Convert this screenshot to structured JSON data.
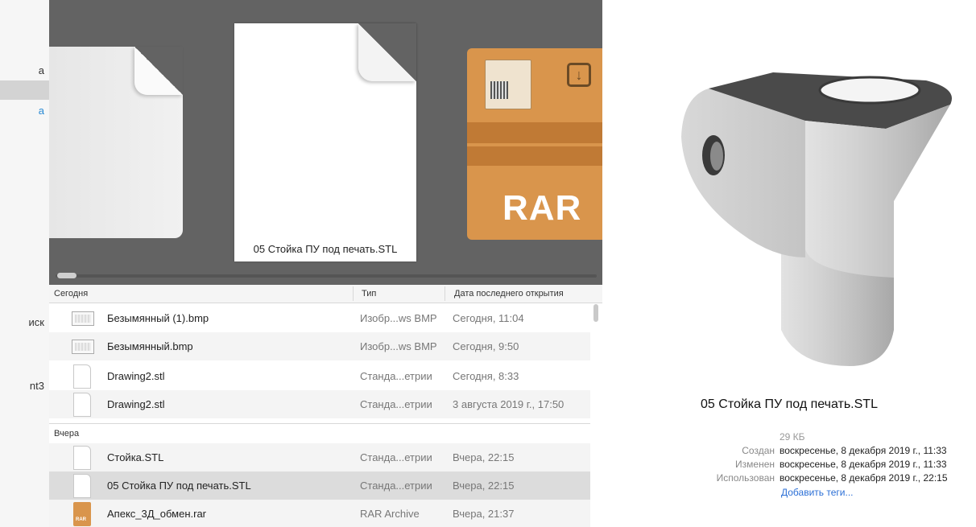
{
  "sidebar": {
    "items": [
      {
        "label": "a",
        "selected": false
      },
      {
        "label": "",
        "selected": true
      },
      {
        "label": "a",
        "selected": false
      },
      {
        "label": "иск",
        "selected": false
      },
      {
        "label": "nt3",
        "selected": false
      }
    ]
  },
  "coverflow": {
    "current_caption": "05 Стойка ПУ под печать.STL",
    "rar_label": "RAR"
  },
  "list": {
    "columns": {
      "name": "Сегодня",
      "type": "Тип",
      "date": "Дата последнего открытия"
    },
    "today_rows": [
      {
        "name": "Безымянный (1).bmp",
        "type": "Изобр...ws BMP",
        "date": "Сегодня, 11:04",
        "icon": "bmp-file-icon"
      },
      {
        "name": "Безымянный.bmp",
        "type": "Изобр...ws BMP",
        "date": "Сегодня, 9:50",
        "icon": "bmp-file-icon"
      },
      {
        "name": "Drawing2.stl",
        "type": "Станда...етрии",
        "date": "Сегодня, 8:33",
        "icon": "stl-file-icon"
      },
      {
        "name": "Drawing2.stl",
        "type": "Станда...етрии",
        "date": "3 августа 2019 г., 17:50",
        "icon": "stl-file-icon"
      }
    ],
    "yesterday_group": "Вчера",
    "yesterday_rows": [
      {
        "name": "Стойка.STL",
        "type": "Станда...етрии",
        "date": "Вчера, 22:15",
        "icon": "stl-file-icon"
      },
      {
        "name": "05 Стойка ПУ под печать.STL",
        "type": "Станда...етрии",
        "date": "Вчера, 22:15",
        "icon": "stl-file-icon",
        "selected": true
      },
      {
        "name": "Апекс_3Д_обмен.rar",
        "type": "RAR Archive",
        "date": "Вчера, 21:37",
        "icon": "rar-file-icon"
      }
    ]
  },
  "preview": {
    "title": "05 Стойка ПУ под печать.STL",
    "size": "29 КБ",
    "created_label": "Создан",
    "created_value": "воскресенье, 8 декабря 2019 г., 11:33",
    "modified_label": "Изменен",
    "modified_value": "воскресенье, 8 декабря 2019 г., 11:33",
    "used_label": "Использован",
    "used_value": "воскресенье, 8 декабря 2019 г., 22:15",
    "add_tags": "Добавить теги..."
  },
  "colors": {
    "coverflow_bg": "#636363",
    "selection": "#dcdcdc",
    "link": "#2b6fd6",
    "rar_orange": "#d9954c"
  }
}
